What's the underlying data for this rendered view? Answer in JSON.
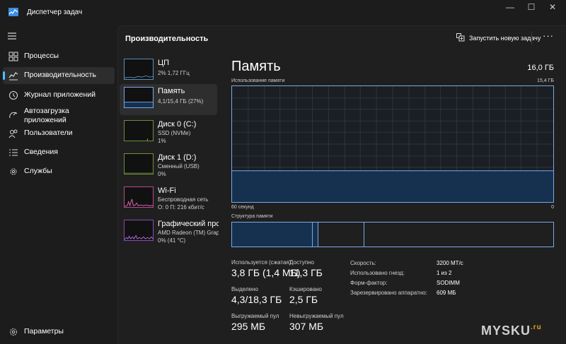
{
  "window": {
    "title": "Диспетчер задач",
    "controls": {
      "minimize": "—",
      "maximize": "☐",
      "close": "✕"
    }
  },
  "sidebar": {
    "items": [
      {
        "label": "Процессы",
        "icon": "processes-icon"
      },
      {
        "label": "Производительность",
        "icon": "performance-icon",
        "active": true
      },
      {
        "label": "Журнал приложений",
        "icon": "history-icon"
      },
      {
        "label": "Автозагрузка приложений",
        "icon": "startup-icon"
      },
      {
        "label": "Пользователи",
        "icon": "users-icon"
      },
      {
        "label": "Сведения",
        "icon": "details-icon"
      },
      {
        "label": "Службы",
        "icon": "services-icon"
      }
    ],
    "settings_label": "Параметры"
  },
  "header": {
    "title": "Производительность",
    "run_task_label": "Запустить новую задачу",
    "more_label": "···"
  },
  "perf_list": [
    {
      "name": "ЦП",
      "sub": [
        "2%  1,72 ГГц"
      ]
    },
    {
      "name": "Память",
      "sub": [
        "4,1/15,4 ГБ (27%)"
      ],
      "active": true
    },
    {
      "name": "Диск 0 (C:)",
      "sub": [
        "SSD (NVMe)",
        "1%"
      ]
    },
    {
      "name": "Диск 1 (D:)",
      "sub": [
        "Сменный (USB)",
        "0%"
      ]
    },
    {
      "name": "Wi-Fi",
      "sub": [
        "Беспроводная сеть",
        "О: 0 П: 216 кбит/с"
      ]
    },
    {
      "name": "Графический прс",
      "sub": [
        "AMD Radeon (TM) Grap",
        "0% (41 °C)"
      ]
    }
  ],
  "memory": {
    "title": "Память",
    "total": "16,0 ГБ",
    "usage_label": "Использование памяти",
    "usage_max": "15,4 ГБ",
    "time_left": "60 секунд",
    "time_right": "0",
    "usage_fraction": 0.27,
    "structure_label": "Структура памяти",
    "stats": {
      "in_use_label": "Используется (сжатая)",
      "in_use_value": "3,8 ГБ (1,4 МБ)",
      "available_label": "Доступно",
      "available_value": "11,3 ГБ",
      "committed_label": "Выделено",
      "committed_value": "4,3/18,3 ГБ",
      "cached_label": "Кэшировано",
      "cached_value": "2,5 ГБ",
      "paged_label": "Выгружаемый пул",
      "paged_value": "295 МБ",
      "nonpaged_label": "Невыгружаемый пул",
      "nonpaged_value": "307 МБ"
    },
    "specs": [
      {
        "k": "Скорость:",
        "v": "3200 МТ/с"
      },
      {
        "k": "Использовано гнезд:",
        "v": "1 из 2"
      },
      {
        "k": "Форм-фактор:",
        "v": "SODIMM"
      },
      {
        "k": "Зарезервировано аппаратно:",
        "v": "609 МБ"
      }
    ]
  },
  "watermark": {
    "text": "MYSKU",
    "suffix": ".ru"
  },
  "colors": {
    "accent": "#4cc2ff",
    "memory_line": "#7aa9e8",
    "memory_fill": "#16304f"
  }
}
